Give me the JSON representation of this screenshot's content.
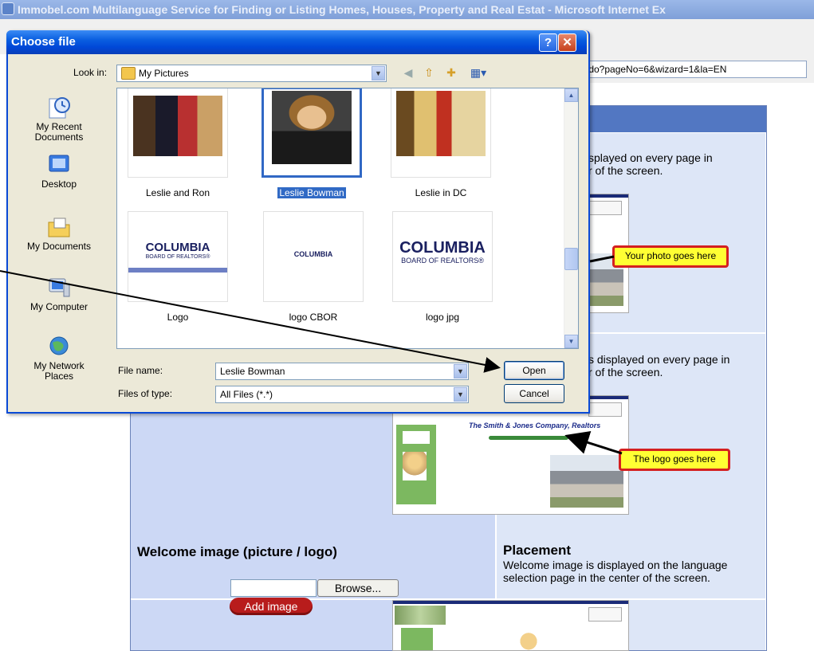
{
  "browser": {
    "title": "Immobel.com Multilanguage Service for Finding or Listing Homes, Houses, Property and Real Estat - Microsoft Internet Ex",
    "address_fragment": ".do?pageNo=6&wizard=1&la=EN"
  },
  "page": {
    "photo_desc": "splayed on every page in\nr of the screen.",
    "photo_callout": "Your photo goes here",
    "logo_desc": "s displayed on every page in\nr of the screen.",
    "logo_callout": "The logo goes here",
    "preview_company": "The Smith & Jones Company, Realtors",
    "welcome_title": "Welcome image (picture / logo)",
    "browse_label": "Browse...",
    "add_image_label": "Add image",
    "placement_title": "Placement",
    "placement_desc": "Welcome image is displayed on the language selection page in the center of the screen."
  },
  "dialog": {
    "title": "Choose file",
    "help_label": "?",
    "close_label": "✕",
    "look_in_label": "Look in:",
    "look_in_value": "My Pictures",
    "places": [
      {
        "label": "My Recent\nDocuments",
        "icon": "recent-documents-icon"
      },
      {
        "label": "Desktop",
        "icon": "desktop-icon"
      },
      {
        "label": "My Documents",
        "icon": "my-documents-icon"
      },
      {
        "label": "My Computer",
        "icon": "my-computer-icon"
      },
      {
        "label": "My Network\nPlaces",
        "icon": "network-places-icon"
      }
    ],
    "files": [
      {
        "name": "Leslie and Ron"
      },
      {
        "name": "Leslie Bowman",
        "selected": true
      },
      {
        "name": "Leslie in DC"
      },
      {
        "name": "Logo",
        "logo_text": "COLUMBIA",
        "logo_sub": "BOARD OF REALTORS®"
      },
      {
        "name": "logo CBOR",
        "logo_text": "COLUMBIA"
      },
      {
        "name": "logo jpg",
        "logo_text": "COLUMBIA",
        "logo_sub": "BOARD OF REALTORS®"
      }
    ],
    "file_name_label": "File name:",
    "file_name_value": "Leslie Bowman",
    "file_type_label": "Files of type:",
    "file_type_value": "All Files (*.*)",
    "open_label": "Open",
    "cancel_label": "Cancel"
  },
  "colors": {
    "titlebar": "#0a4ad6",
    "header_bar": "#5277c2",
    "callout_fill": "#ffff33",
    "callout_border": "#d42020",
    "add_image_button": "#b81c1c"
  }
}
